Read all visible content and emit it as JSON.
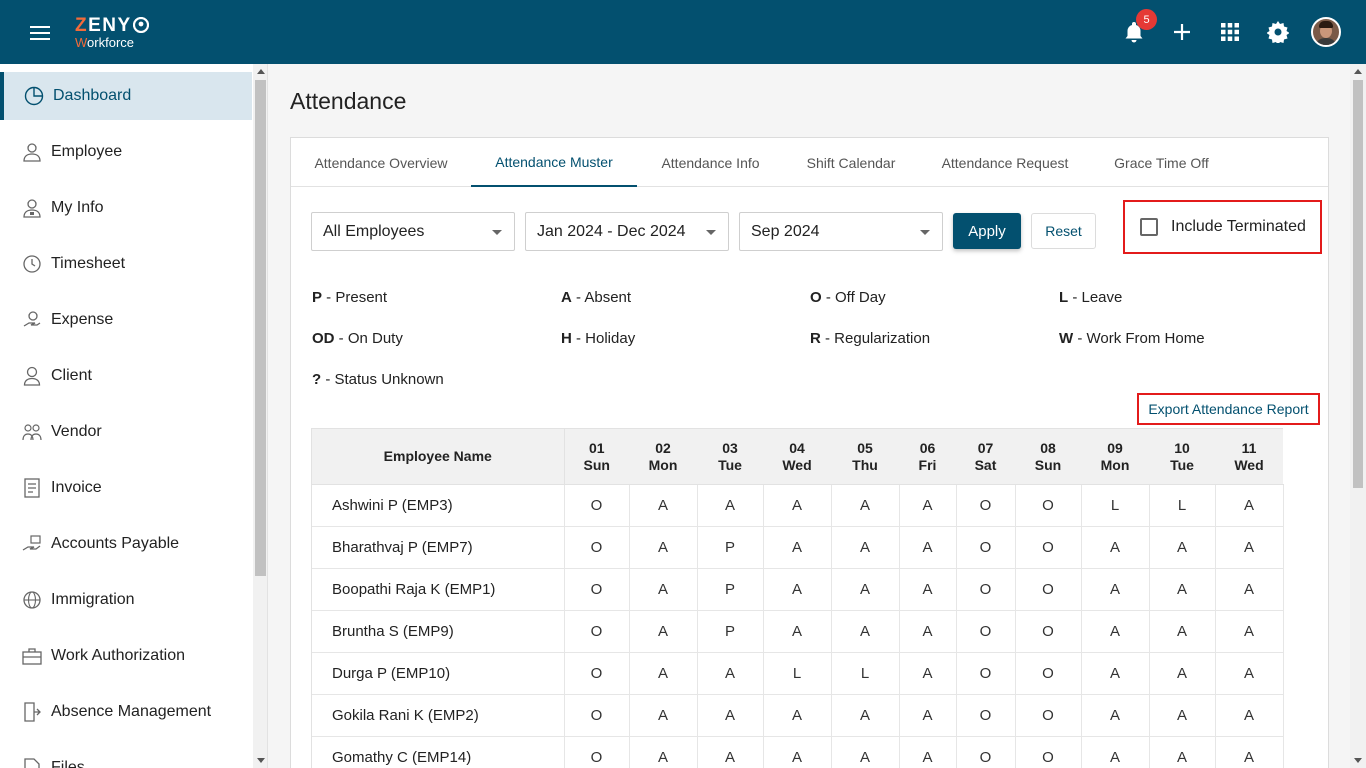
{
  "app": {
    "brand_top": "ZENY",
    "brand_sub": "Workforce",
    "notification_count": "5"
  },
  "sidebar": {
    "items": [
      {
        "label": "Dashboard",
        "icon": "dashboard-icon"
      },
      {
        "label": "Employee",
        "icon": "employee-icon"
      },
      {
        "label": "My Info",
        "icon": "my-info-icon"
      },
      {
        "label": "Timesheet",
        "icon": "clock-icon"
      },
      {
        "label": "Expense",
        "icon": "expense-icon"
      },
      {
        "label": "Client",
        "icon": "client-icon"
      },
      {
        "label": "Vendor",
        "icon": "vendor-icon"
      },
      {
        "label": "Invoice",
        "icon": "invoice-icon"
      },
      {
        "label": "Accounts Payable",
        "icon": "accounts-payable-icon"
      },
      {
        "label": "Immigration",
        "icon": "globe-icon"
      },
      {
        "label": "Work Authorization",
        "icon": "briefcase-icon"
      },
      {
        "label": "Absence Management",
        "icon": "exit-icon"
      },
      {
        "label": "Files",
        "icon": "file-icon"
      }
    ]
  },
  "page": {
    "title": "Attendance"
  },
  "tabs": [
    {
      "label": "Attendance Overview"
    },
    {
      "label": "Attendance Muster"
    },
    {
      "label": "Attendance Info"
    },
    {
      "label": "Shift Calendar"
    },
    {
      "label": "Attendance Request"
    },
    {
      "label": "Grace Time Off"
    }
  ],
  "filters": {
    "employees": "All Employees",
    "period": "Jan 2024 - Dec 2024",
    "month": "Sep 2024",
    "apply_label": "Apply",
    "reset_label": "Reset",
    "include_terminated_label": "Include Terminated"
  },
  "legend": [
    {
      "code": "P",
      "text": " - Present"
    },
    {
      "code": "A",
      "text": " - Absent"
    },
    {
      "code": "O",
      "text": " - Off Day"
    },
    {
      "code": "L",
      "text": " - Leave"
    },
    {
      "code": "OD",
      "text": " - On Duty"
    },
    {
      "code": "H",
      "text": " - Holiday"
    },
    {
      "code": "R",
      "text": " - Regularization"
    },
    {
      "code": "W",
      "text": " - Work From Home"
    },
    {
      "code": "?",
      "text": " - Status Unknown"
    }
  ],
  "export_label": "Export Attendance Report",
  "table": {
    "name_header": "Employee Name",
    "days": [
      {
        "num": "01",
        "day": "Sun"
      },
      {
        "num": "02",
        "day": "Mon"
      },
      {
        "num": "03",
        "day": "Tue"
      },
      {
        "num": "04",
        "day": "Wed"
      },
      {
        "num": "05",
        "day": "Thu"
      },
      {
        "num": "06",
        "day": "Fri"
      },
      {
        "num": "07",
        "day": "Sat"
      },
      {
        "num": "08",
        "day": "Sun"
      },
      {
        "num": "09",
        "day": "Mon"
      },
      {
        "num": "10",
        "day": "Tue"
      },
      {
        "num": "11",
        "day": "Wed"
      }
    ],
    "rows": [
      {
        "name": "Ashwini P (EMP3)",
        "values": [
          "O",
          "A",
          "A",
          "A",
          "A",
          "A",
          "O",
          "O",
          "L",
          "L",
          "A"
        ]
      },
      {
        "name": "Bharathvaj P (EMP7)",
        "values": [
          "O",
          "A",
          "P",
          "A",
          "A",
          "A",
          "O",
          "O",
          "A",
          "A",
          "A"
        ]
      },
      {
        "name": "Boopathi Raja K (EMP1)",
        "values": [
          "O",
          "A",
          "P",
          "A",
          "A",
          "A",
          "O",
          "O",
          "A",
          "A",
          "A"
        ]
      },
      {
        "name": "Bruntha S (EMP9)",
        "values": [
          "O",
          "A",
          "P",
          "A",
          "A",
          "A",
          "O",
          "O",
          "A",
          "A",
          "A"
        ]
      },
      {
        "name": "Durga P (EMP10)",
        "values": [
          "O",
          "A",
          "A",
          "L",
          "L",
          "A",
          "O",
          "O",
          "A",
          "A",
          "A"
        ]
      },
      {
        "name": "Gokila Rani K (EMP2)",
        "values": [
          "O",
          "A",
          "A",
          "A",
          "A",
          "A",
          "O",
          "O",
          "A",
          "A",
          "A"
        ]
      },
      {
        "name": "Gomathy C (EMP14)",
        "values": [
          "O",
          "A",
          "A",
          "A",
          "A",
          "A",
          "O",
          "O",
          "A",
          "A",
          "A"
        ]
      }
    ]
  },
  "colors": {
    "primary": "#03506f",
    "accent": "#f26b3a",
    "highlight_border": "#e31b1b",
    "badge": "#e53935"
  }
}
